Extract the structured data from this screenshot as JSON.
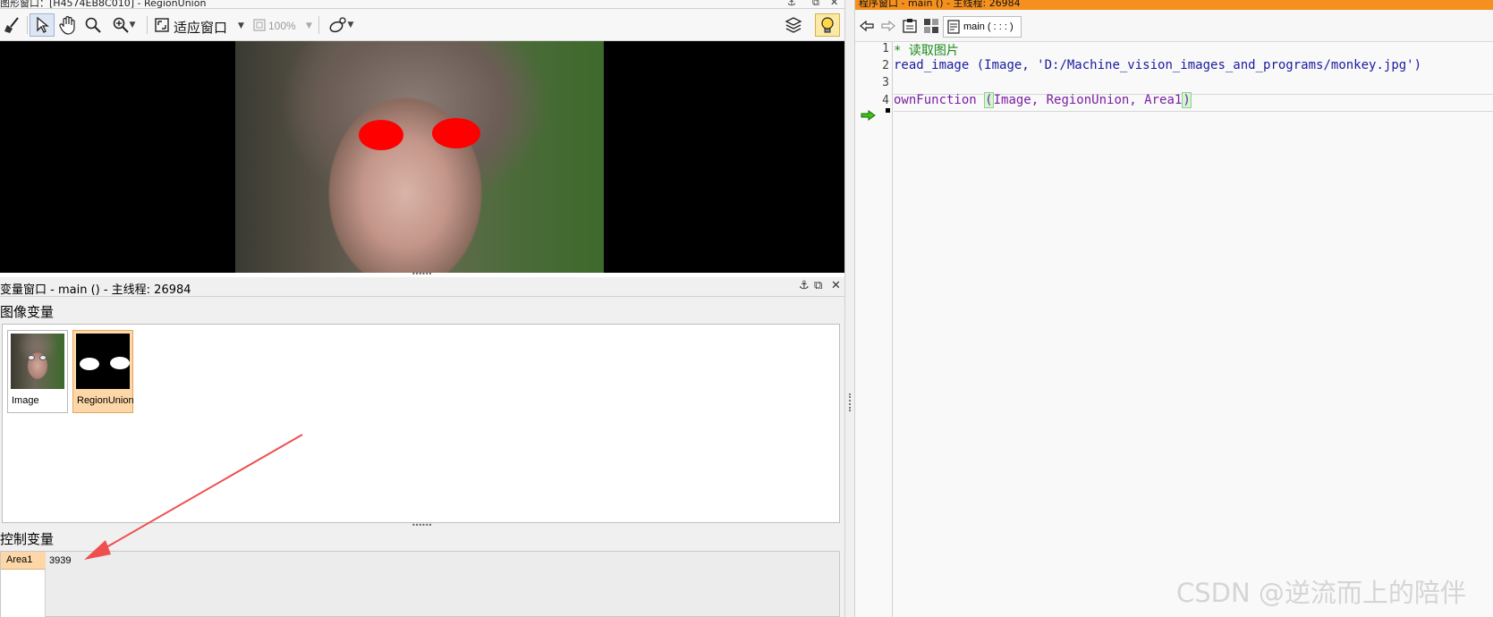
{
  "graphics_window": {
    "title": "图形窗口：[H4574EB8C010] - RegionUnion",
    "toolbar": {
      "fit_window_label": "适应窗口",
      "zoom_value": "100%"
    }
  },
  "variable_window": {
    "title": "变量窗口 - main () - 主线程: 26984",
    "iconic_section_label": "图像变量",
    "iconic_variables": [
      {
        "name": "Image",
        "selected": false
      },
      {
        "name": "RegionUnion",
        "selected": true
      }
    ],
    "control_section_label": "控制变量",
    "control_variables": [
      {
        "name": "Area1",
        "value": "3939"
      }
    ]
  },
  "program_window": {
    "title": "程序窗口 - main () - 主线程: 26984",
    "procedure_tab_label": "main ( : : : )",
    "lines": [
      {
        "number": "1",
        "comment": "* 读取图片"
      },
      {
        "number": "2",
        "operator": "read_image",
        "args": "(Image, 'D:/Machine_vision_images_and_programs/monkey.jpg')"
      },
      {
        "number": "3"
      },
      {
        "number": "4",
        "procedure": "ownFunction",
        "open_paren": "(",
        "args": "Image, RegionUnion, Area1",
        "close_paren": ")"
      }
    ]
  },
  "watermark": "CSDN @逆流而上的陪伴",
  "colors": {
    "program_title_bar": "#f5901e",
    "selected_variable": "#fdd7a8",
    "region_fill": "#ff0000",
    "annotation_arrow": "#ef4f4f"
  }
}
